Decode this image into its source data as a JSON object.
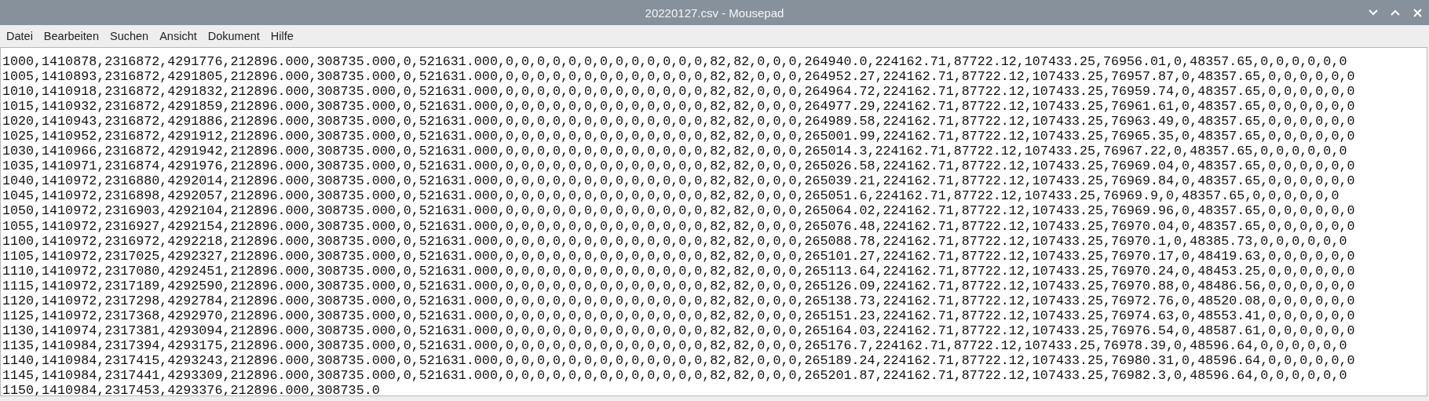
{
  "window": {
    "title": "20220127.csv - Mousepad"
  },
  "menu": [
    "Datei",
    "Bearbeiten",
    "Suchen",
    "Ansicht",
    "Dokument",
    "Hilfe"
  ],
  "lines": [
    "1000,1410878,2316872,4291776,212896.000,308735.000,0,521631.000,0,0,0,0,0,0,0,0,0,0,0,0,0,82,82,0,0,0,264940.0,224162.71,87722.12,107433.25,76956.01,0,48357.65,0,0,0,0,0,0",
    "1005,1410893,2316872,4291805,212896.000,308735.000,0,521631.000,0,0,0,0,0,0,0,0,0,0,0,0,0,82,82,0,0,0,264952.27,224162.71,87722.12,107433.25,76957.87,0,48357.65,0,0,0,0,0,0",
    "1010,1410918,2316872,4291832,212896.000,308735.000,0,521631.000,0,0,0,0,0,0,0,0,0,0,0,0,0,82,82,0,0,0,264964.72,224162.71,87722.12,107433.25,76959.74,0,48357.65,0,0,0,0,0,0",
    "1015,1410932,2316872,4291859,212896.000,308735.000,0,521631.000,0,0,0,0,0,0,0,0,0,0,0,0,0,82,82,0,0,0,264977.29,224162.71,87722.12,107433.25,76961.61,0,48357.65,0,0,0,0,0,0",
    "1020,1410943,2316872,4291886,212896.000,308735.000,0,521631.000,0,0,0,0,0,0,0,0,0,0,0,0,0,82,82,0,0,0,264989.58,224162.71,87722.12,107433.25,76963.49,0,48357.65,0,0,0,0,0,0",
    "1025,1410952,2316872,4291912,212896.000,308735.000,0,521631.000,0,0,0,0,0,0,0,0,0,0,0,0,0,82,82,0,0,0,265001.99,224162.71,87722.12,107433.25,76965.35,0,48357.65,0,0,0,0,0,0",
    "1030,1410966,2316872,4291942,212896.000,308735.000,0,521631.000,0,0,0,0,0,0,0,0,0,0,0,0,0,82,82,0,0,0,265014.3,224162.71,87722.12,107433.25,76967.22,0,48357.65,0,0,0,0,0,0",
    "1035,1410971,2316874,4291976,212896.000,308735.000,0,521631.000,0,0,0,0,0,0,0,0,0,0,0,0,0,82,82,0,0,0,265026.58,224162.71,87722.12,107433.25,76969.04,0,48357.65,0,0,0,0,0,0",
    "1040,1410972,2316880,4292014,212896.000,308735.000,0,521631.000,0,0,0,0,0,0,0,0,0,0,0,0,0,82,82,0,0,0,265039.21,224162.71,87722.12,107433.25,76969.84,0,48357.65,0,0,0,0,0,0",
    "1045,1410972,2316898,4292057,212896.000,308735.000,0,521631.000,0,0,0,0,0,0,0,0,0,0,0,0,0,82,82,0,0,0,265051.6,224162.71,87722.12,107433.25,76969.9,0,48357.65,0,0,0,0,0,0",
    "1050,1410972,2316903,4292104,212896.000,308735.000,0,521631.000,0,0,0,0,0,0,0,0,0,0,0,0,0,82,82,0,0,0,265064.02,224162.71,87722.12,107433.25,76969.96,0,48357.65,0,0,0,0,0,0",
    "1055,1410972,2316927,4292154,212896.000,308735.000,0,521631.000,0,0,0,0,0,0,0,0,0,0,0,0,0,82,82,0,0,0,265076.48,224162.71,87722.12,107433.25,76970.04,0,48357.65,0,0,0,0,0,0",
    "1100,1410972,2316972,4292218,212896.000,308735.000,0,521631.000,0,0,0,0,0,0,0,0,0,0,0,0,0,82,82,0,0,0,265088.78,224162.71,87722.12,107433.25,76970.1,0,48385.73,0,0,0,0,0,0",
    "1105,1410972,2317025,4292327,212896.000,308735.000,0,521631.000,0,0,0,0,0,0,0,0,0,0,0,0,0,82,82,0,0,0,265101.27,224162.71,87722.12,107433.25,76970.17,0,48419.63,0,0,0,0,0,0",
    "1110,1410972,2317080,4292451,212896.000,308735.000,0,521631.000,0,0,0,0,0,0,0,0,0,0,0,0,0,82,82,0,0,0,265113.64,224162.71,87722.12,107433.25,76970.24,0,48453.25,0,0,0,0,0,0",
    "1115,1410972,2317189,4292590,212896.000,308735.000,0,521631.000,0,0,0,0,0,0,0,0,0,0,0,0,0,82,82,0,0,0,265126.09,224162.71,87722.12,107433.25,76970.88,0,48486.56,0,0,0,0,0,0",
    "1120,1410972,2317298,4292784,212896.000,308735.000,0,521631.000,0,0,0,0,0,0,0,0,0,0,0,0,0,82,82,0,0,0,265138.73,224162.71,87722.12,107433.25,76972.76,0,48520.08,0,0,0,0,0,0",
    "1125,1410972,2317368,4292970,212896.000,308735.000,0,521631.000,0,0,0,0,0,0,0,0,0,0,0,0,0,82,82,0,0,0,265151.23,224162.71,87722.12,107433.25,76974.63,0,48553.41,0,0,0,0,0,0",
    "1130,1410974,2317381,4293094,212896.000,308735.000,0,521631.000,0,0,0,0,0,0,0,0,0,0,0,0,0,82,82,0,0,0,265164.03,224162.71,87722.12,107433.25,76976.54,0,48587.61,0,0,0,0,0,0",
    "1135,1410984,2317394,4293175,212896.000,308735.000,0,521631.000,0,0,0,0,0,0,0,0,0,0,0,0,0,82,82,0,0,0,265176.7,224162.71,87722.12,107433.25,76978.39,0,48596.64,0,0,0,0,0,0",
    "1140,1410984,2317415,4293243,212896.000,308735.000,0,521631.000,0,0,0,0,0,0,0,0,0,0,0,0,0,82,82,0,0,0,265189.24,224162.71,87722.12,107433.25,76980.31,0,48596.64,0,0,0,0,0,0",
    "1145,1410984,2317441,4293309,212896.000,308735.000,0,521631.000,0,0,0,0,0,0,0,0,0,0,0,0,0,82,82,0,0,0,265201.87,224162.71,87722.12,107433.25,76982.3,0,48596.64,0,0,0,0,0,0",
    "1150,1410984,2317453,4293376,212896.000,308735.0"
  ]
}
